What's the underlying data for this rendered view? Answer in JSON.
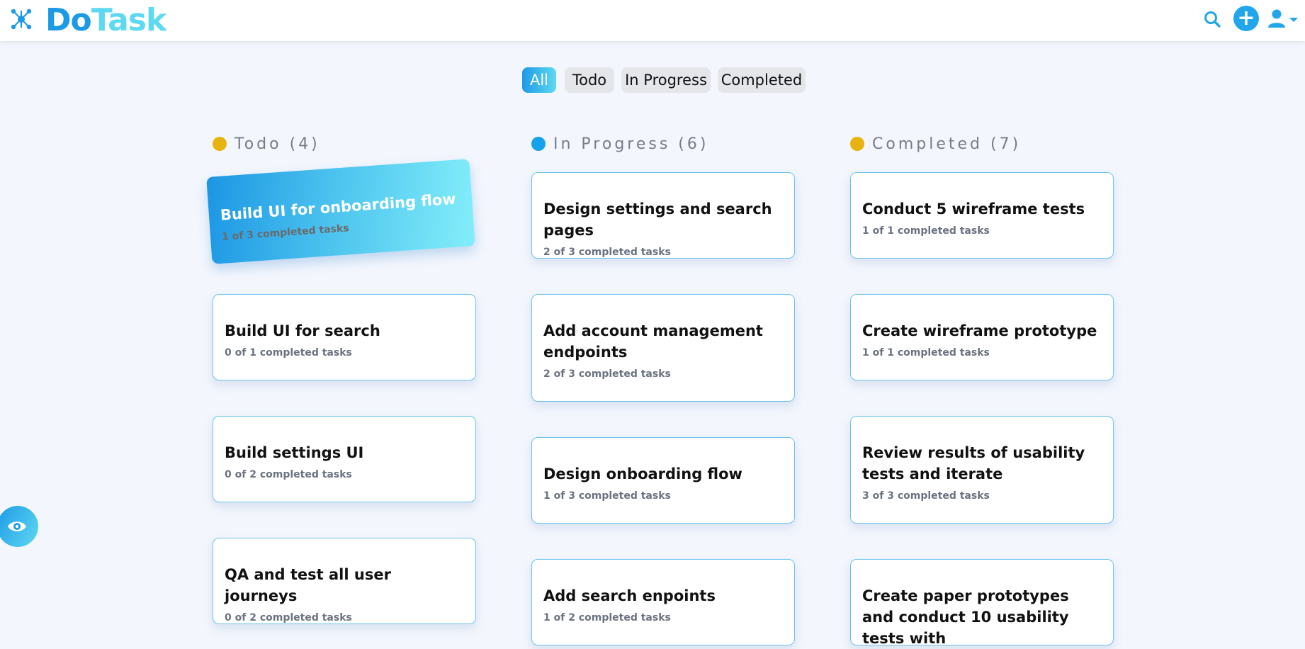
{
  "app": {
    "brand_do": "Do",
    "brand_task": "Task"
  },
  "filters": [
    {
      "label": "All",
      "active": true
    },
    {
      "label": "Todo",
      "active": false
    },
    {
      "label": "In Progress",
      "active": false
    },
    {
      "label": "Completed",
      "active": false
    }
  ],
  "columns": [
    {
      "heading": "Todo (4)",
      "dot_color": "#e7b40f",
      "cards": [
        {
          "title": "Build UI for onboarding flow",
          "sub": "1 of 3 completed tasks"
        },
        {
          "title": "Build UI for search",
          "sub": "0 of 1 completed tasks"
        },
        {
          "title": "Build settings UI",
          "sub": "0 of 2 completed tasks"
        },
        {
          "title": "QA and test all user journeys",
          "sub": "0 of 2 completed tasks"
        }
      ]
    },
    {
      "heading": "In Progress (6)",
      "dot_color": "#16a2ea",
      "cards": [
        {
          "title": "Design settings and search pages",
          "sub": "2 of 3 completed tasks"
        },
        {
          "title": "Add account management endpoints",
          "sub": "2 of 3 completed tasks"
        },
        {
          "title": "Design onboarding flow",
          "sub": "1 of 3 completed tasks"
        },
        {
          "title": "Add search enpoints",
          "sub": "1 of 2 completed tasks"
        }
      ]
    },
    {
      "heading": "Completed (7)",
      "dot_color": "#e7b40f",
      "cards": [
        {
          "title": "Conduct 5 wireframe tests",
          "sub": "1 of 1 completed tasks"
        },
        {
          "title": "Create wireframe prototype",
          "sub": "1 of 1 completed tasks"
        },
        {
          "title": "Review results of usability tests and iterate",
          "sub": "3 of 3 completed tasks"
        },
        {
          "title": "Create paper prototypes and conduct 10 usability tests with",
          "sub": ""
        }
      ]
    }
  ],
  "icons": {
    "logo": "network-logo-icon",
    "search": "search-icon",
    "add": "plus-icon",
    "user": "user-icon",
    "chevron": "chevron-down-icon",
    "eye": "eye-icon"
  },
  "colors": {
    "accent": "#1d9ae6",
    "accent_light": "#5fd9f2",
    "background": "#f3f6fd"
  }
}
